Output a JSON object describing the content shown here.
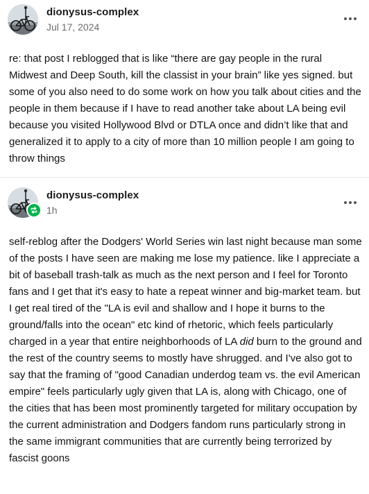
{
  "posts": [
    {
      "username": "dionysus-complex",
      "timestamp": "Jul 17, 2024",
      "body": "re: that post I reblogged that is like “there are gay people in the rural Midwest and Deep South, kill the classist in your brain” like yes signed. but some of you also need to do some work on how you talk about cities and the people in them because if I have to read another take about LA being evil because you visited Hollywood Blvd or DTLA once and didn’t like that and generalized it to apply to a city of more than 10 million people I am going to throw things"
    },
    {
      "username": "dionysus-complex",
      "timestamp": "1h",
      "body_before_italic": "self-reblog after the Dodgers' World Series win last night because man some of the posts I have seen are making me lose my patience. like I appreciate a bit of baseball trash-talk as much as the next person and I feel for Toronto fans and I get that it's easy to hate a repeat winner and big-market team. but I get real tired of the \"LA is evil and shallow and I hope it burns to the ground/falls into the ocean\" etc kind of rhetoric, which feels particularly charged in a year that entire neighborhoods of LA ",
      "body_italic": "did",
      "body_after_italic": " burn to the ground and the rest of the country seems to mostly have shrugged. and I've also got to say that the framing of \"good Canadian underdog team vs. the evil American empire\" feels particularly ugly given that LA is, along with Chicago, one of the cities that has been most prominently targeted for military occupation by the current administration and Dodgers fandom runs particularly strong in the same immigrant communities that are currently being terrorized by fascist goons"
    }
  ],
  "icons": {
    "avatar": "avatar-bicycle-photo",
    "menu": "more-horizontal-icon",
    "reblog": "reblog-icon"
  },
  "colors": {
    "reblog_badge": "#00b24a",
    "timestamp": "#6b6b6b",
    "divider": "#e6e6e6"
  }
}
